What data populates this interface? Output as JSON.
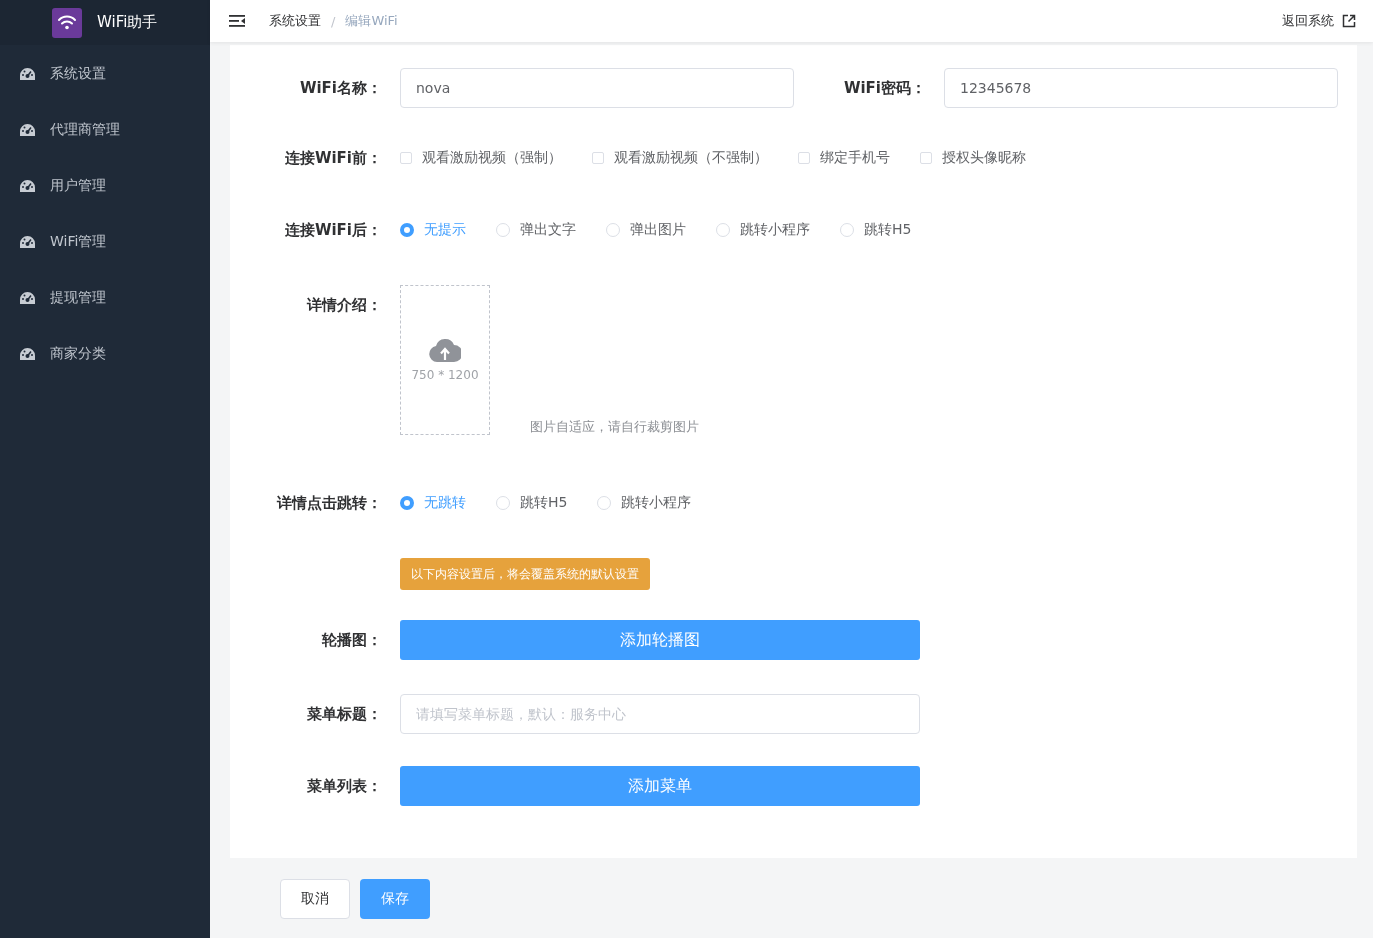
{
  "sidebar": {
    "logo_text": "WiFi助手",
    "items": [
      {
        "label": "系统设置"
      },
      {
        "label": "代理商管理"
      },
      {
        "label": "用户管理"
      },
      {
        "label": "WiFi管理"
      },
      {
        "label": "提现管理"
      },
      {
        "label": "商家分类"
      }
    ]
  },
  "header": {
    "breadcrumb": [
      {
        "label": "系统设置",
        "current": false
      },
      {
        "label": "编辑WiFi",
        "current": true
      }
    ],
    "separator": "/",
    "return_link": "返回系统"
  },
  "form": {
    "name_field": {
      "label": "WiFi名称：",
      "value": "nova"
    },
    "password_field": {
      "label": "WiFi密码：",
      "value": "12345678"
    },
    "before_connect": {
      "label": "连接WiFi前：",
      "options": [
        {
          "label": "观看激励视频（强制）",
          "checked": false
        },
        {
          "label": "观看激励视频（不强制）",
          "checked": false
        },
        {
          "label": "绑定手机号",
          "checked": false
        },
        {
          "label": "授权头像昵称",
          "checked": false
        }
      ]
    },
    "after_connect": {
      "label": "连接WiFi后：",
      "options": [
        {
          "label": "无提示",
          "selected": true
        },
        {
          "label": "弹出文字",
          "selected": false
        },
        {
          "label": "弹出图片",
          "selected": false
        },
        {
          "label": "跳转小程序",
          "selected": false
        },
        {
          "label": "跳转H5",
          "selected": false
        }
      ]
    },
    "detail": {
      "label": "详情介绍：",
      "upload_size": "750 * 1200",
      "note": "图片自适应，请自行裁剪图片"
    },
    "detail_jump": {
      "label": "详情点击跳转：",
      "options": [
        {
          "label": "无跳转",
          "selected": true
        },
        {
          "label": "跳转H5",
          "selected": false
        },
        {
          "label": "跳转小程序",
          "selected": false
        }
      ]
    },
    "notice": "以下内容设置后，将会覆盖系统的默认设置",
    "carousel": {
      "label": "轮播图：",
      "button": "添加轮播图"
    },
    "menu_title": {
      "label": "菜单标题：",
      "placeholder": "请填写菜单标题，默认：服务中心"
    },
    "menu_list": {
      "label": "菜单列表：",
      "button": "添加菜单"
    }
  },
  "footer": {
    "cancel": "取消",
    "save": "保存"
  }
}
